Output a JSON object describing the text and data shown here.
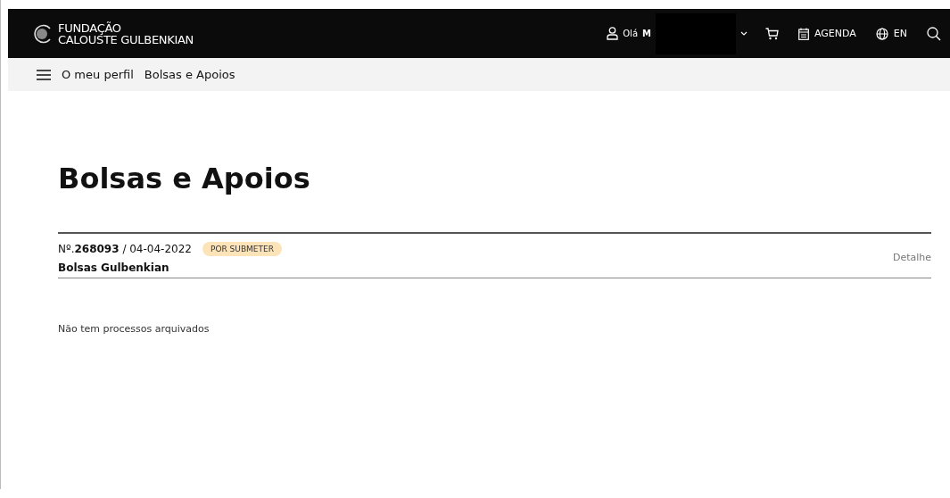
{
  "header": {
    "logo_line_1": "FUNDAÇÃO",
    "logo_line_2": "CALOUSTE GULBENKIAN",
    "greeting": "Olá",
    "user_name": "M",
    "agenda": "AGENDA",
    "language": "EN"
  },
  "breadcrumb": [
    "O meu perfil",
    "Bolsas e Apoios"
  ],
  "page_title": "Bolsas e Apoios",
  "applications": [
    {
      "reference": "Nº.**268093** / 04-04-2022",
      "status": "POR SUBMETER",
      "programme": "Bolsas Gulbenkian",
      "action": "Detalhe"
    }
  ],
  "archived_message": "Não tem processos arquivados"
}
